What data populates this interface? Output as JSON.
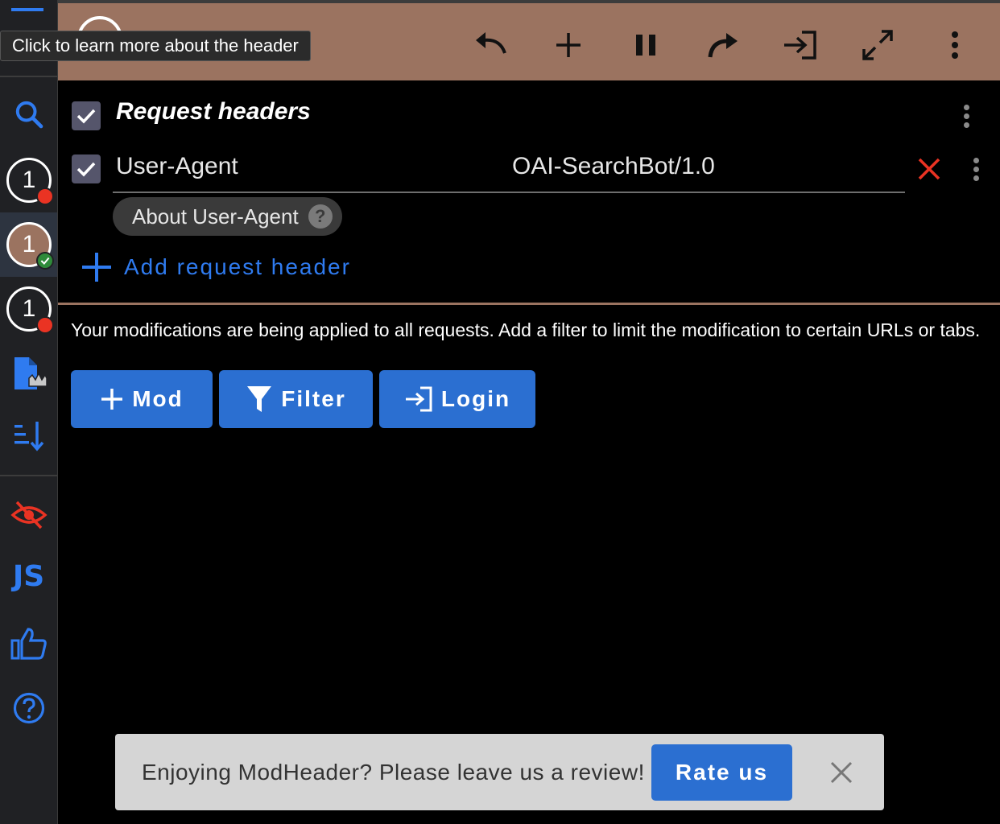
{
  "tooltip": "Click to learn more about the header",
  "sidebar": {
    "profiles": [
      {
        "label": "1",
        "status": "error"
      },
      {
        "label": "1",
        "status": "active"
      },
      {
        "label": "1",
        "status": "error"
      }
    ],
    "js_label": "JS"
  },
  "toolbar": {
    "icons": [
      "undo-icon",
      "add-icon",
      "pause-icon",
      "redo-icon",
      "login-icon",
      "expand-icon",
      "more-vert-icon"
    ]
  },
  "group": {
    "title": "Request headers",
    "checked": true
  },
  "headers": [
    {
      "name": "User-Agent",
      "value": "OAI-SearchBot/1.0",
      "checked": true,
      "about_label": "About User-Agent"
    }
  ],
  "add_header_label": "Add request header",
  "info_text": "Your modifications are being applied to all requests. Add a filter to limit the modification to certain URLs or tabs.",
  "buttons": {
    "mod": "Mod",
    "filter": "Filter",
    "login": "Login"
  },
  "snackbar": {
    "message": "Enjoying ModHeader? Please leave us a review!",
    "action": "Rate us"
  },
  "colors": {
    "header_bg": "#9b7360",
    "accent_blue": "#2b6fd1",
    "link_blue": "#2f7bf0",
    "error_red": "#ea3323",
    "success_green": "#2e8b3a"
  }
}
